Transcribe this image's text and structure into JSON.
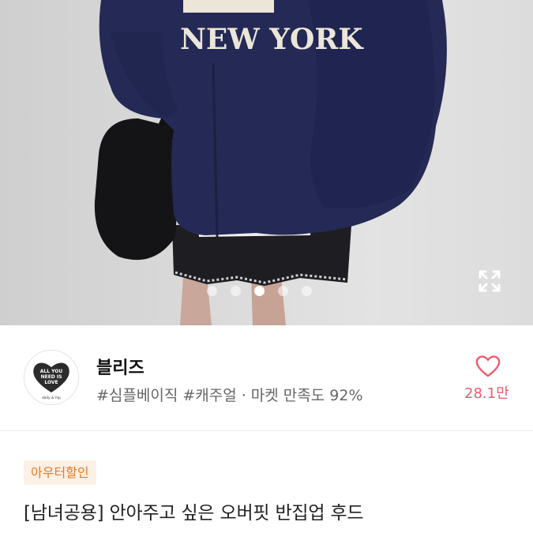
{
  "gallery": {
    "sweater_print": "NEW YORK",
    "total_slides": 5,
    "active_slide": 3
  },
  "shop": {
    "name": "블리즈",
    "logo_text_top": "ALL YOU NEED IS LOVE",
    "logo_text_bottom": "daily & hip",
    "tags": [
      "#심플베이직",
      "#캐주얼",
      "· 마켓 만족도 92%"
    ],
    "like_count": "28.1만"
  },
  "product": {
    "badge": "아우터할인",
    "title": "[남녀공용] 안아주고 싶은 오버핏 반집업 후드"
  },
  "colors": {
    "accent": "#f05a6e",
    "badge_bg": "#fdf0e4",
    "badge_text": "#e07a2a",
    "sweater": "#242a55"
  }
}
